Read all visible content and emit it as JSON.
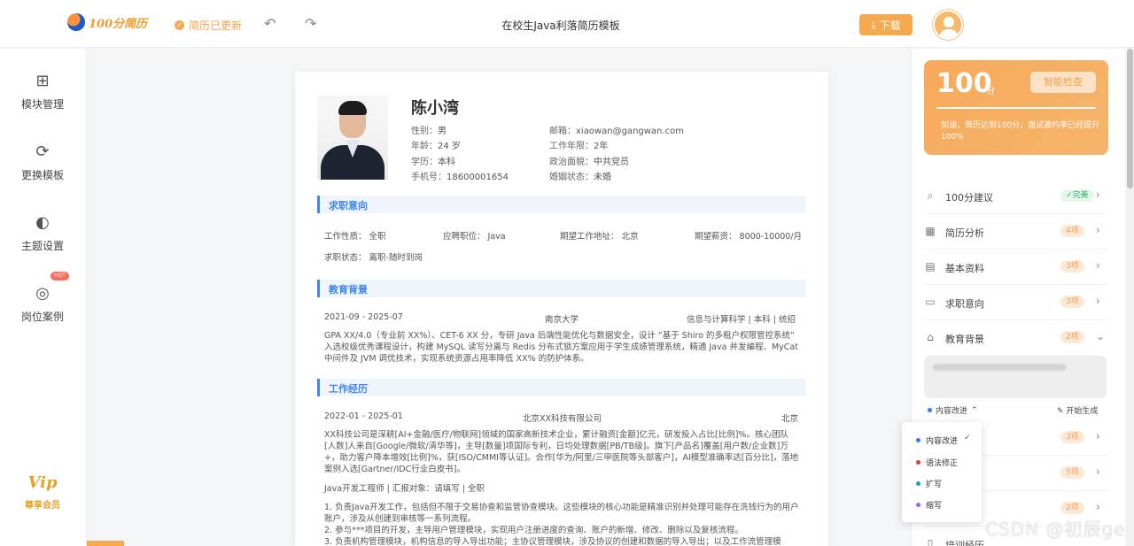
{
  "topbar": {
    "logo_text": "100分简历",
    "saved_status": "简历已更新",
    "doc_title": "在校生Java利落简历模板",
    "download_label": "下载"
  },
  "sidebar": {
    "items": [
      {
        "label": "模块管理",
        "icon": "grid-icon"
      },
      {
        "label": "更换模板",
        "icon": "swap-icon"
      },
      {
        "label": "主题设置",
        "icon": "palette-icon"
      },
      {
        "label": "岗位案例",
        "icon": "target-icon",
        "badge": "HOT"
      }
    ],
    "vip_label": "尊享会员"
  },
  "resume": {
    "name": "陈小湾",
    "basic": {
      "gender": {
        "k": "性别：",
        "v": "男"
      },
      "age": {
        "k": "年龄：",
        "v": "24 岁"
      },
      "degree": {
        "k": "学历：",
        "v": "本科"
      },
      "phone": {
        "k": "手机号：",
        "v": "18600001654"
      },
      "email": {
        "k": "邮箱：",
        "v": "xiaowan@gangwan.com"
      },
      "years": {
        "k": "工作年限：",
        "v": "2年"
      },
      "politics": {
        "k": "政治面貌：",
        "v": "中共党员"
      },
      "marital": {
        "k": "婚姻状态：",
        "v": "未婚"
      }
    },
    "intent": {
      "title": "求职意向",
      "type": "工作性质：  全职",
      "position": "应聘职位：  Java",
      "city": "期望工作地址：  北京",
      "salary": "期望薪资：  8000-10000/月",
      "status": "求职状态：  离职-随时到岗"
    },
    "education": {
      "title": "教育背景",
      "period": "2021-09 - 2025-07",
      "school": "南京大学",
      "major": "信息与计算科学 | 本科 | 统招",
      "desc": "GPA XX/4.0（专业前 XX%）、CET-6 XX 分，专研 Java 后端性能优化与数据安全，设计 “基于 Shiro 的多租户权限管控系统” 入选校级优秀课程设计，构建 MySQL 读写分离与 Redis 分布式锁方案应用于学生成绩管理系统，精通 Java 并发编程、MyCat 中间件及 JVM 调优技术，实现系统资源占用率降低 XX% 的防护体系。"
    },
    "work": {
      "title": "工作经历",
      "period": "2022-01 - 2025-01",
      "company": "北京XX科技有限公司",
      "city": "北京",
      "desc": "XX科技公司是深耕[AI+金融/医疗/物联网]领域的国家高新技术企业，累计融资[金额]亿元，研发投入占比[比例]%。核心团队[人数]人来自[Google/微软/清华等]，主导[数量]项国际专利，日均处理数据[PB/TB级]。旗下[产品名]覆盖[用户数/企业数]万+，助力客户降本增效[比例]%，获[ISO/CMMI等认证]。合作[华为/阿里/三甲医院等头部客户]，AI模型准确率达[百分比]，落地案例入选[Gartner/IDC行业白皮书]。",
      "role_line": "Java开发工程师  |  汇报对象：请填写  |  全职",
      "duty1": "1. 负责Java开发工作，包括但不限于交易协查和监管协查模块。这些模块的核心功能是精准识别并处理可能存在洗钱行为的用户账户，涉及从创建到审核等一系列流程。",
      "duty2": "2. 参与***项目的开发，主导用户管理模块，实现用户注册进度的查询、账户的新增、修改、删除以及复核流程。",
      "duty3": "3. 负责机构管理模块，机构信息的导入导出功能；主协议管理模块，涉及协议的创建和数据的导入导出；以及工作流管理模"
    }
  },
  "panel": {
    "score": "100",
    "score_unit": "分",
    "check_label": "智能检查",
    "tip": "加油，简历达到100分，面试邀约率已经提升100%",
    "items": [
      {
        "label": "100分建议",
        "badge": "✓完美",
        "badge_type": "done",
        "icon": "search-icon"
      },
      {
        "label": "简历分析",
        "badge": "4项",
        "badge_type": "todo",
        "icon": "chart-icon"
      },
      {
        "label": "基本资料",
        "badge": "3项",
        "badge_type": "todo",
        "icon": "idcard-icon"
      },
      {
        "label": "求职意向",
        "badge": "3项",
        "badge_type": "todo",
        "icon": "briefcase-icon"
      },
      {
        "label": "教育背景",
        "badge": "2项",
        "badge_type": "todo",
        "icon": "graduation-icon"
      }
    ],
    "lower_badges": [
      "3项",
      "5项",
      "2项"
    ],
    "lower_label": "培训经历",
    "mode_label": "内容改进",
    "generate_label": "开始生成"
  },
  "dropdown": {
    "options": [
      {
        "label": "内容改进",
        "color": "#2f7cf6"
      },
      {
        "label": "语法修正",
        "color": "#e53935"
      },
      {
        "label": "扩写",
        "color": "#17a2b8"
      },
      {
        "label": "缩写",
        "color": "#9c6ade"
      }
    ]
  },
  "watermark": "CSDN @初辰ge"
}
